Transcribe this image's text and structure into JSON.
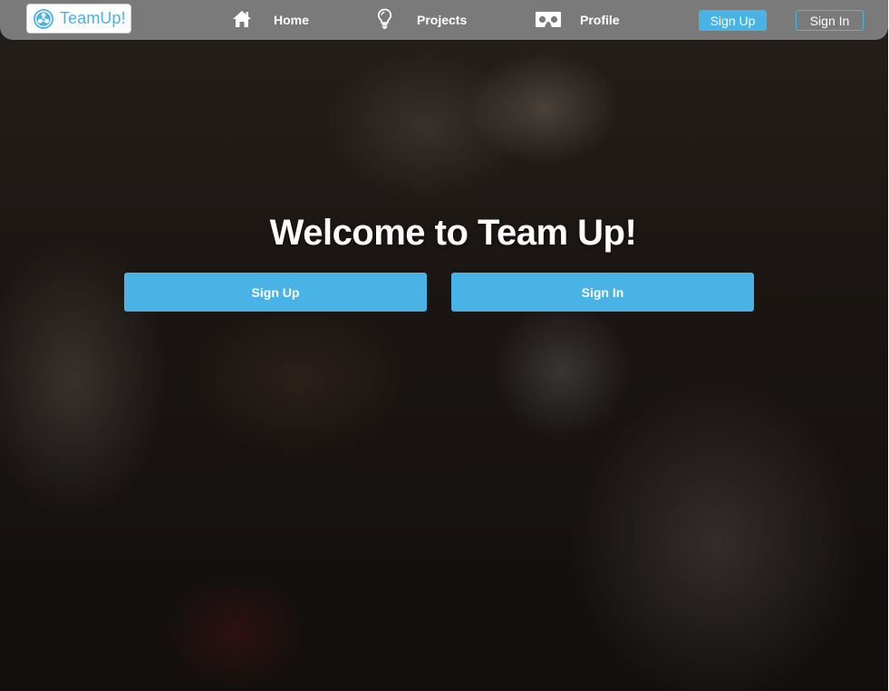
{
  "brand": {
    "name": "TeamUp!",
    "icon": "teamup-logo-icon",
    "color": "#4ab3e6"
  },
  "nav": {
    "items": [
      {
        "label": "Home",
        "icon": "home-icon"
      },
      {
        "label": "Projects",
        "icon": "lightbulb-icon"
      },
      {
        "label": "Profile",
        "icon": "vr-headset-icon"
      }
    ],
    "signup_label": "Sign Up",
    "signin_label": "Sign In",
    "background": "#7a7a7a"
  },
  "hero": {
    "title": "Welcome to Team Up!",
    "signup_label": "Sign Up",
    "signin_label": "Sign In",
    "accent": "#4ab3e6"
  }
}
